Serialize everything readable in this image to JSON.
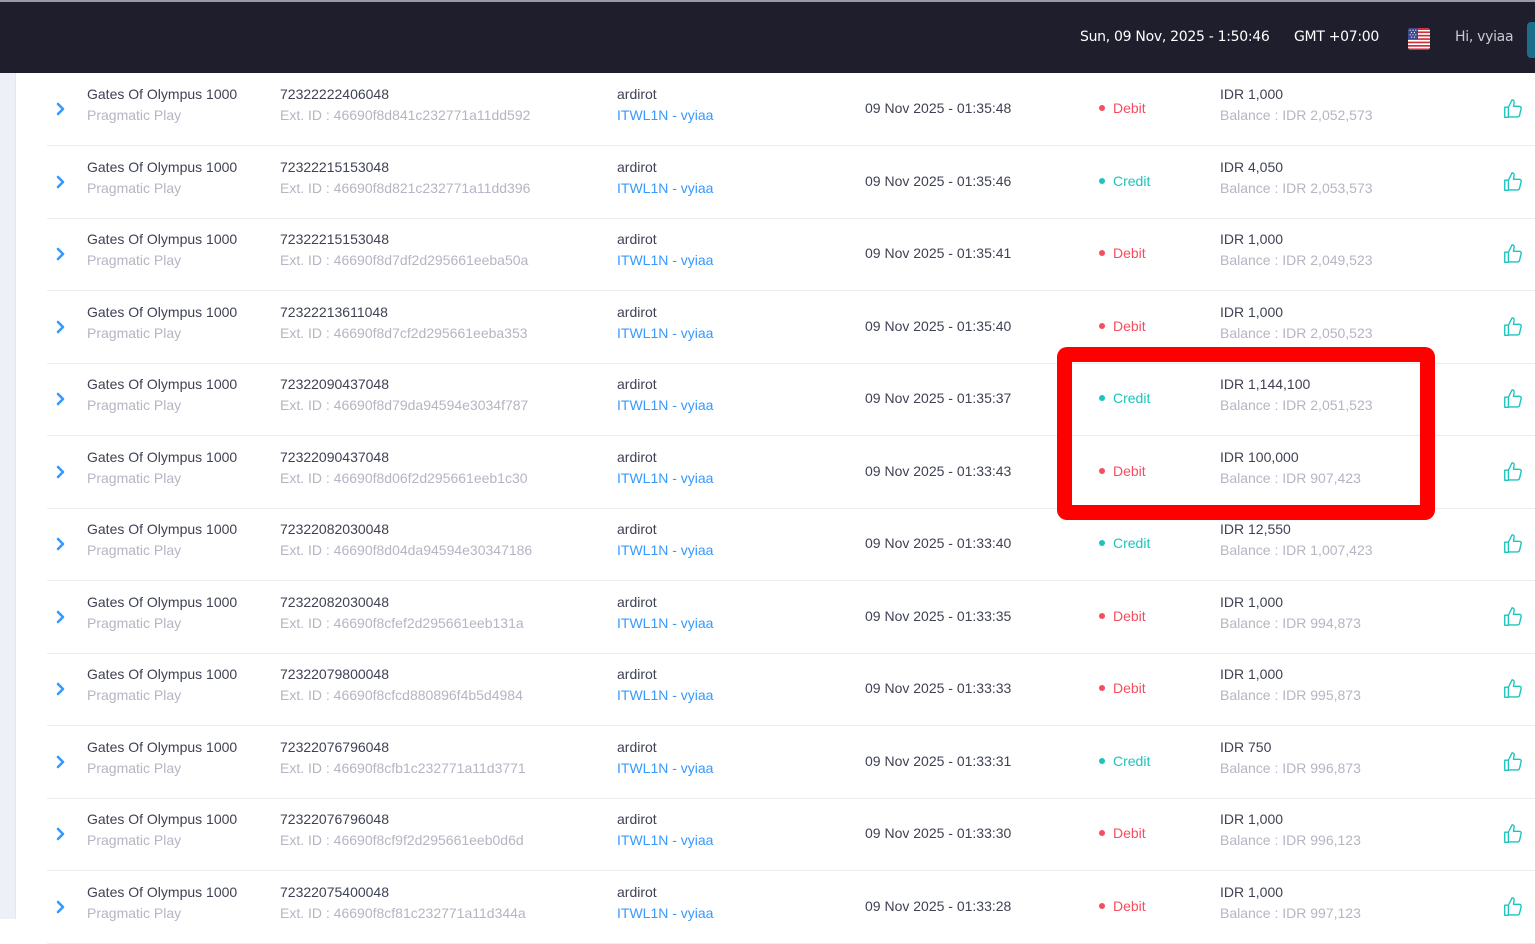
{
  "header": {
    "datetime": "Sun, 09 Nov, 2025 - 1:50:46",
    "timezone": "GMT +07:00",
    "greeting": "Hi, vyiaa",
    "flag_icon": "us-flag-icon"
  },
  "colors": {
    "debit": "#f64e60",
    "credit": "#1bc5bd",
    "link": "#3699ff",
    "highlight": "#ff0000",
    "header_bg": "#1e1e2d"
  },
  "transactions": [
    {
      "game": "Gates Of Olympus 1000",
      "provider": "Pragmatic Play",
      "tx_id": "72322222406048",
      "ext_id": "Ext. ID : 46690f8d841c232771a11dd592",
      "user": "ardirot",
      "agent": "ITWL1N - vyiaa",
      "time": "09 Nov 2025 - 01:35:48",
      "type": "Debit",
      "amount": "IDR 1,000",
      "balance": "Balance : IDR 2,052,573"
    },
    {
      "game": "Gates Of Olympus 1000",
      "provider": "Pragmatic Play",
      "tx_id": "72322215153048",
      "ext_id": "Ext. ID : 46690f8d821c232771a11dd396",
      "user": "ardirot",
      "agent": "ITWL1N - vyiaa",
      "time": "09 Nov 2025 - 01:35:46",
      "type": "Credit",
      "amount": "IDR 4,050",
      "balance": "Balance : IDR 2,053,573"
    },
    {
      "game": "Gates Of Olympus 1000",
      "provider": "Pragmatic Play",
      "tx_id": "72322215153048",
      "ext_id": "Ext. ID : 46690f8d7df2d295661eeba50a",
      "user": "ardirot",
      "agent": "ITWL1N - vyiaa",
      "time": "09 Nov 2025 - 01:35:41",
      "type": "Debit",
      "amount": "IDR 1,000",
      "balance": "Balance : IDR 2,049,523"
    },
    {
      "game": "Gates Of Olympus 1000",
      "provider": "Pragmatic Play",
      "tx_id": "72322213611048",
      "ext_id": "Ext. ID : 46690f8d7cf2d295661eeba353",
      "user": "ardirot",
      "agent": "ITWL1N - vyiaa",
      "time": "09 Nov 2025 - 01:35:40",
      "type": "Debit",
      "amount": "IDR 1,000",
      "balance": "Balance : IDR 2,050,523"
    },
    {
      "game": "Gates Of Olympus 1000",
      "provider": "Pragmatic Play",
      "tx_id": "72322090437048",
      "ext_id": "Ext. ID : 46690f8d79da94594e3034f787",
      "user": "ardirot",
      "agent": "ITWL1N - vyiaa",
      "time": "09 Nov 2025 - 01:35:37",
      "type": "Credit",
      "amount": "IDR 1,144,100",
      "balance": "Balance : IDR 2,051,523"
    },
    {
      "game": "Gates Of Olympus 1000",
      "provider": "Pragmatic Play",
      "tx_id": "72322090437048",
      "ext_id": "Ext. ID : 46690f8d06f2d295661eeb1c30",
      "user": "ardirot",
      "agent": "ITWL1N - vyiaa",
      "time": "09 Nov 2025 - 01:33:43",
      "type": "Debit",
      "amount": "IDR 100,000",
      "balance": "Balance : IDR 907,423"
    },
    {
      "game": "Gates Of Olympus 1000",
      "provider": "Pragmatic Play",
      "tx_id": "72322082030048",
      "ext_id": "Ext. ID : 46690f8d04da94594e30347186",
      "user": "ardirot",
      "agent": "ITWL1N - vyiaa",
      "time": "09 Nov 2025 - 01:33:40",
      "type": "Credit",
      "amount": "IDR 12,550",
      "balance": "Balance : IDR 1,007,423"
    },
    {
      "game": "Gates Of Olympus 1000",
      "provider": "Pragmatic Play",
      "tx_id": "72322082030048",
      "ext_id": "Ext. ID : 46690f8cfef2d295661eeb131a",
      "user": "ardirot",
      "agent": "ITWL1N - vyiaa",
      "time": "09 Nov 2025 - 01:33:35",
      "type": "Debit",
      "amount": "IDR 1,000",
      "balance": "Balance : IDR 994,873"
    },
    {
      "game": "Gates Of Olympus 1000",
      "provider": "Pragmatic Play",
      "tx_id": "72322079800048",
      "ext_id": "Ext. ID : 46690f8cfcd880896f4b5d4984",
      "user": "ardirot",
      "agent": "ITWL1N - vyiaa",
      "time": "09 Nov 2025 - 01:33:33",
      "type": "Debit",
      "amount": "IDR 1,000",
      "balance": "Balance : IDR 995,873"
    },
    {
      "game": "Gates Of Olympus 1000",
      "provider": "Pragmatic Play",
      "tx_id": "72322076796048",
      "ext_id": "Ext. ID : 46690f8cfb1c232771a11d3771",
      "user": "ardirot",
      "agent": "ITWL1N - vyiaa",
      "time": "09 Nov 2025 - 01:33:31",
      "type": "Credit",
      "amount": "IDR 750",
      "balance": "Balance : IDR 996,873"
    },
    {
      "game": "Gates Of Olympus 1000",
      "provider": "Pragmatic Play",
      "tx_id": "72322076796048",
      "ext_id": "Ext. ID : 46690f8cf9f2d295661eeb0d6d",
      "user": "ardirot",
      "agent": "ITWL1N - vyiaa",
      "time": "09 Nov 2025 - 01:33:30",
      "type": "Debit",
      "amount": "IDR 1,000",
      "balance": "Balance : IDR 996,123"
    },
    {
      "game": "Gates Of Olympus 1000",
      "provider": "Pragmatic Play",
      "tx_id": "72322075400048",
      "ext_id": "Ext. ID : 46690f8cf81c232771a11d344a",
      "user": "ardirot",
      "agent": "ITWL1N - vyiaa",
      "time": "09 Nov 2025 - 01:33:28",
      "type": "Debit",
      "amount": "IDR 1,000",
      "balance": "Balance : IDR 997,123"
    }
  ]
}
